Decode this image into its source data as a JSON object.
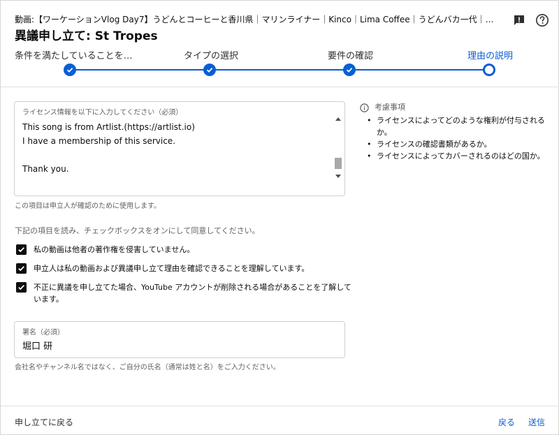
{
  "header": {
    "video_title": "動画:【ワーケーションVlog Day7】うどんとコーヒーと香川県｜マリンライナー｜Kinco｜Lima Coffee｜うどんバカ一代｜しんぺいうどん…",
    "dialog_title": "異議申し立て: St Tropes",
    "icons": {
      "feedback": "feedback-icon",
      "help": "help-icon"
    }
  },
  "stepper": {
    "steps": [
      {
        "label": "条件を満たしていることを…",
        "state": "done"
      },
      {
        "label": "タイプの選択",
        "state": "done"
      },
      {
        "label": "要件の確認",
        "state": "done"
      },
      {
        "label": "理由の説明",
        "state": "current"
      }
    ]
  },
  "license": {
    "label": "ライセンス情報を以下に入力してください（必須）",
    "value": "This song is from Artlist.(https://artlist.io)\nI have a membership of this service.\n\nThank you.",
    "helper": "この項目は申立人が確認のために使用します。"
  },
  "agreements": {
    "intro": "下記の項目を読み、チェックボックスをオンにして同意してください。",
    "items": [
      {
        "label": "私の動画は他者の著作権を侵害していません。",
        "checked": true
      },
      {
        "label": "申立人は私の動画および異議申し立て理由を確認できることを理解しています。",
        "checked": true
      },
      {
        "label": "不正に異議を申し立てた場合、YouTube アカウントが削除される場合があることを了解しています。",
        "checked": true
      }
    ]
  },
  "signature": {
    "label": "署名（必須）",
    "value": "堀口 研",
    "helper": "会社名やチャンネル名ではなく、ご自分の氏名（通常は姓と名）をご入力ください。"
  },
  "considerations": {
    "title": "考慮事項",
    "items": [
      "ライセンスによってどのような権利が付与されるか。",
      "ライセンスの確認書類があるか。",
      "ライセンスによってカバーされるのはどの国か。"
    ]
  },
  "footer": {
    "back_label": "申し立てに戻る",
    "prev_label": "戻る",
    "submit_label": "送信"
  },
  "colors": {
    "accent": "#065fd4",
    "text": "#0d0d0d",
    "secondary": "#606060",
    "border": "#cfcfcf"
  }
}
